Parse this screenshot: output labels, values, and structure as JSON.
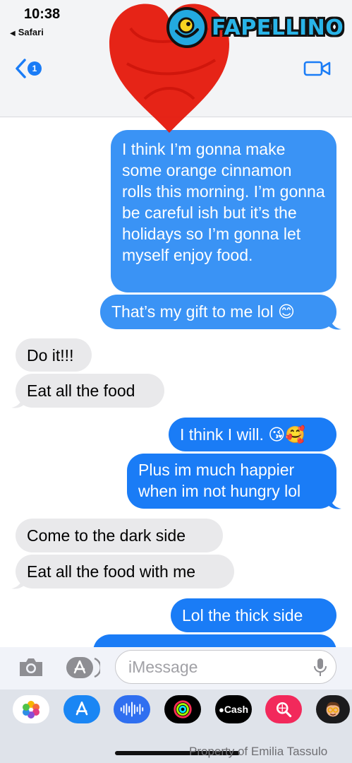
{
  "status_bar": {
    "time": "10:38",
    "back_app": "Safari"
  },
  "nav": {
    "back_badge": "1"
  },
  "overlay": {
    "logo_text": "FAPELLINO"
  },
  "messages": [
    {
      "type": "sent",
      "text": "I think I’m gonna make some orange cinnamon rolls this morning. I’m gonna be careful ish but it’s the holidays so I’m gonna let myself enjoy food."
    },
    {
      "type": "sent",
      "text": "That’s my gift to me lol 😊"
    },
    {
      "type": "received",
      "text": "Do it!!!"
    },
    {
      "type": "received",
      "text": "Eat all the food"
    },
    {
      "type": "sent",
      "text": "I think I will. 😘🥰"
    },
    {
      "type": "sent",
      "text": "Plus im much happier when im not hungry lol"
    },
    {
      "type": "received",
      "text": "Come to the dark side"
    },
    {
      "type": "received",
      "text": "Eat all the food with me"
    },
    {
      "type": "sent",
      "text": "Lol the thick side"
    }
  ],
  "input": {
    "placeholder": "iMessage"
  },
  "apps": [
    {
      "name": "photos-icon"
    },
    {
      "name": "app-store-icon"
    },
    {
      "name": "audio-message-icon"
    },
    {
      "name": "fitness-icon"
    },
    {
      "name": "apple-cash-icon",
      "label": "Cash"
    },
    {
      "name": "images-search-icon"
    },
    {
      "name": "memoji-icon"
    }
  ],
  "watermark": "Property of Emilia Tassulo",
  "colors": {
    "sent": "#1a7cf6",
    "received": "#e9e9eb",
    "accent": "#1a7cf6"
  }
}
